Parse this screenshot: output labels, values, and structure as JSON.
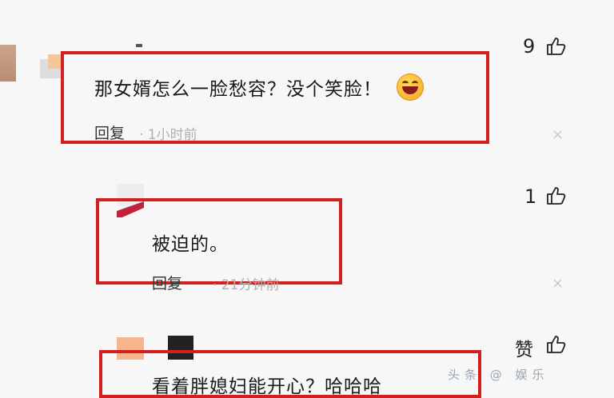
{
  "comments": [
    {
      "text": "那女婿怎么一脸愁容？没个笑脸！",
      "reply_label": "回复",
      "meta": "· 1小时前",
      "likes": "9",
      "close": "×"
    },
    {
      "text": "被迫的。",
      "reply_label": "回复",
      "meta": "· 21分钟前",
      "likes": "1",
      "close": "×"
    },
    {
      "text": "看着胖媳妇能开心？哈哈哈",
      "likes": "赞"
    }
  ],
  "watermark": "头条 @ 娱乐"
}
